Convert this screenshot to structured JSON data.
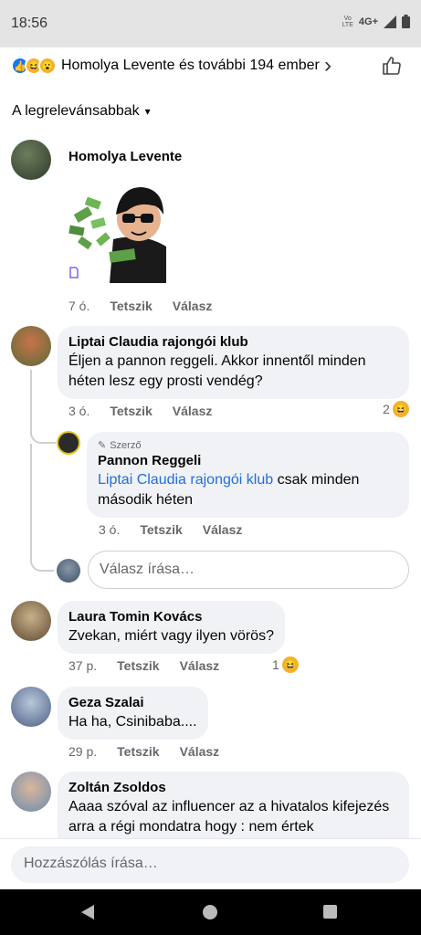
{
  "status": {
    "time": "18:56",
    "volte": "Vo\nLTE",
    "network": "4G+"
  },
  "reactions": {
    "text": "Homolya Levente és további 194 ember"
  },
  "sort": {
    "label": "A legrelevánsabbak"
  },
  "comments": [
    {
      "name": "Homolya Levente",
      "time": "7 ó.",
      "like": "Tetszik",
      "reply": "Válasz"
    },
    {
      "name": "Liptai Claudia rajongói klub",
      "text": "Éljen a pannon reggeli. Akkor innentől minden héten lesz egy prosti vendég?",
      "time": "3 ó.",
      "like": "Tetszik",
      "reply": "Válasz",
      "reaction_count": "2"
    },
    {
      "name": "Laura Tomin Kovács",
      "text": "Zvekan, miért vagy ilyen vörös?",
      "time": "37 p.",
      "like": "Tetszik",
      "reply": "Válasz",
      "reaction_count": "1"
    },
    {
      "name": "Geza Szalai",
      "text": "Ha ha, Csinibaba....",
      "time": "29 p.",
      "like": "Tetszik",
      "reply": "Válasz"
    },
    {
      "name": "Zoltán Zsoldos",
      "text": "Aaaa szóval az influencer az a hivatalos kifejezés arra a régi mondatra hogy : nem értek"
    }
  ],
  "reply": {
    "badge": "Szerző",
    "name": "Pannon Reggeli",
    "mention": "Liptai Claudia rajongói klub",
    "text": " csak minden második héten",
    "time": "3 ó.",
    "like": "Tetszik",
    "reply": "Válasz"
  },
  "reply_input": {
    "placeholder": "Válasz írása…"
  },
  "comment_input": {
    "placeholder": "Hozzászólás írása…"
  }
}
